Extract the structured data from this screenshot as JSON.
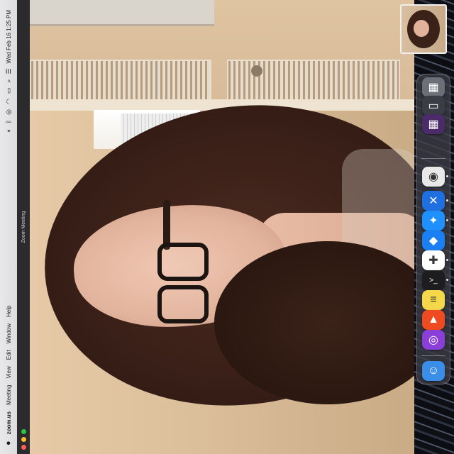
{
  "menubar": {
    "apple_icon": "apple-icon",
    "app_name": "zoom.us",
    "menus": [
      "Meeting",
      "View",
      "Edit",
      "Window",
      "Help"
    ],
    "status_icons": [
      "control-center-icon",
      "bluetooth-icon",
      "siri-icon",
      "wifi-icon",
      "battery-icon",
      "search-icon",
      "notification-icon"
    ],
    "clock": "Wed Feb 16  1:25 PM"
  },
  "window": {
    "title": "Zoom Meeting",
    "traffic_lights": {
      "close": "#ff5f57",
      "minimize": "#febc2e",
      "zoom": "#28c840"
    }
  },
  "video": {
    "subject": "participant-video"
  },
  "dock": {
    "icons": [
      {
        "name": "recents-stack-icon",
        "glyph": "▦",
        "color": "#6b6f78"
      },
      {
        "name": "finder-window-thumb-icon",
        "glyph": "▭",
        "color": "#3a3d46"
      },
      {
        "name": "app-window-thumb-icon",
        "glyph": "▦",
        "color": "#4b2b6a"
      },
      {
        "name": "chrome-icon",
        "glyph": "◉",
        "color": "#e8e8e8"
      },
      {
        "name": "zoom-icon",
        "glyph": "✕",
        "color": "#1f6fe0"
      },
      {
        "name": "safari-icon",
        "glyph": "✦",
        "color": "#1e90ff"
      },
      {
        "name": "storage-app-icon",
        "glyph": "◆",
        "color": "#1a7ff2"
      },
      {
        "name": "slack-icon",
        "glyph": "✚",
        "color": "#ffffff"
      },
      {
        "name": "terminal-icon",
        "glyph": ">_",
        "color": "#1d1d1f"
      },
      {
        "name": "notes-icon",
        "glyph": "≡",
        "color": "#f5d84a"
      },
      {
        "name": "brave-icon",
        "glyph": "▲",
        "color": "#ef4b23"
      },
      {
        "name": "podcasts-icon",
        "glyph": "◎",
        "color": "#8b3fd9"
      },
      {
        "name": "finder-icon",
        "glyph": "☺",
        "color": "#3a8ee8"
      }
    ]
  }
}
